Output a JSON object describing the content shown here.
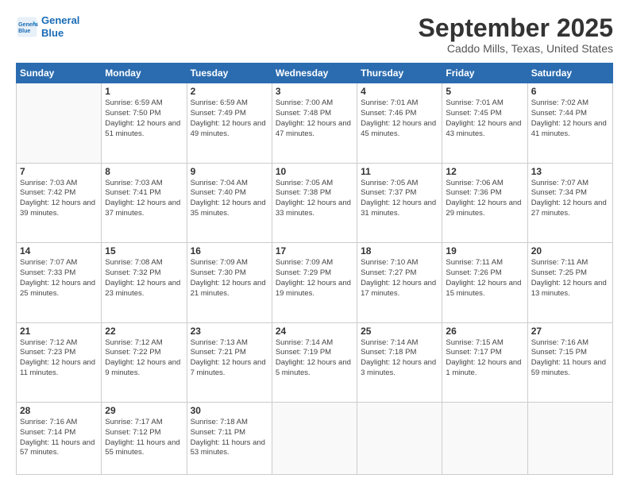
{
  "logo": {
    "line1": "General",
    "line2": "Blue"
  },
  "title": "September 2025",
  "location": "Caddo Mills, Texas, United States",
  "days_of_week": [
    "Sunday",
    "Monday",
    "Tuesday",
    "Wednesday",
    "Thursday",
    "Friday",
    "Saturday"
  ],
  "weeks": [
    [
      {
        "day": "",
        "sunrise": "",
        "sunset": "",
        "daylight": ""
      },
      {
        "day": "1",
        "sunrise": "Sunrise: 6:59 AM",
        "sunset": "Sunset: 7:50 PM",
        "daylight": "Daylight: 12 hours and 51 minutes."
      },
      {
        "day": "2",
        "sunrise": "Sunrise: 6:59 AM",
        "sunset": "Sunset: 7:49 PM",
        "daylight": "Daylight: 12 hours and 49 minutes."
      },
      {
        "day": "3",
        "sunrise": "Sunrise: 7:00 AM",
        "sunset": "Sunset: 7:48 PM",
        "daylight": "Daylight: 12 hours and 47 minutes."
      },
      {
        "day": "4",
        "sunrise": "Sunrise: 7:01 AM",
        "sunset": "Sunset: 7:46 PM",
        "daylight": "Daylight: 12 hours and 45 minutes."
      },
      {
        "day": "5",
        "sunrise": "Sunrise: 7:01 AM",
        "sunset": "Sunset: 7:45 PM",
        "daylight": "Daylight: 12 hours and 43 minutes."
      },
      {
        "day": "6",
        "sunrise": "Sunrise: 7:02 AM",
        "sunset": "Sunset: 7:44 PM",
        "daylight": "Daylight: 12 hours and 41 minutes."
      }
    ],
    [
      {
        "day": "7",
        "sunrise": "Sunrise: 7:03 AM",
        "sunset": "Sunset: 7:42 PM",
        "daylight": "Daylight: 12 hours and 39 minutes."
      },
      {
        "day": "8",
        "sunrise": "Sunrise: 7:03 AM",
        "sunset": "Sunset: 7:41 PM",
        "daylight": "Daylight: 12 hours and 37 minutes."
      },
      {
        "day": "9",
        "sunrise": "Sunrise: 7:04 AM",
        "sunset": "Sunset: 7:40 PM",
        "daylight": "Daylight: 12 hours and 35 minutes."
      },
      {
        "day": "10",
        "sunrise": "Sunrise: 7:05 AM",
        "sunset": "Sunset: 7:38 PM",
        "daylight": "Daylight: 12 hours and 33 minutes."
      },
      {
        "day": "11",
        "sunrise": "Sunrise: 7:05 AM",
        "sunset": "Sunset: 7:37 PM",
        "daylight": "Daylight: 12 hours and 31 minutes."
      },
      {
        "day": "12",
        "sunrise": "Sunrise: 7:06 AM",
        "sunset": "Sunset: 7:36 PM",
        "daylight": "Daylight: 12 hours and 29 minutes."
      },
      {
        "day": "13",
        "sunrise": "Sunrise: 7:07 AM",
        "sunset": "Sunset: 7:34 PM",
        "daylight": "Daylight: 12 hours and 27 minutes."
      }
    ],
    [
      {
        "day": "14",
        "sunrise": "Sunrise: 7:07 AM",
        "sunset": "Sunset: 7:33 PM",
        "daylight": "Daylight: 12 hours and 25 minutes."
      },
      {
        "day": "15",
        "sunrise": "Sunrise: 7:08 AM",
        "sunset": "Sunset: 7:32 PM",
        "daylight": "Daylight: 12 hours and 23 minutes."
      },
      {
        "day": "16",
        "sunrise": "Sunrise: 7:09 AM",
        "sunset": "Sunset: 7:30 PM",
        "daylight": "Daylight: 12 hours and 21 minutes."
      },
      {
        "day": "17",
        "sunrise": "Sunrise: 7:09 AM",
        "sunset": "Sunset: 7:29 PM",
        "daylight": "Daylight: 12 hours and 19 minutes."
      },
      {
        "day": "18",
        "sunrise": "Sunrise: 7:10 AM",
        "sunset": "Sunset: 7:27 PM",
        "daylight": "Daylight: 12 hours and 17 minutes."
      },
      {
        "day": "19",
        "sunrise": "Sunrise: 7:11 AM",
        "sunset": "Sunset: 7:26 PM",
        "daylight": "Daylight: 12 hours and 15 minutes."
      },
      {
        "day": "20",
        "sunrise": "Sunrise: 7:11 AM",
        "sunset": "Sunset: 7:25 PM",
        "daylight": "Daylight: 12 hours and 13 minutes."
      }
    ],
    [
      {
        "day": "21",
        "sunrise": "Sunrise: 7:12 AM",
        "sunset": "Sunset: 7:23 PM",
        "daylight": "Daylight: 12 hours and 11 minutes."
      },
      {
        "day": "22",
        "sunrise": "Sunrise: 7:12 AM",
        "sunset": "Sunset: 7:22 PM",
        "daylight": "Daylight: 12 hours and 9 minutes."
      },
      {
        "day": "23",
        "sunrise": "Sunrise: 7:13 AM",
        "sunset": "Sunset: 7:21 PM",
        "daylight": "Daylight: 12 hours and 7 minutes."
      },
      {
        "day": "24",
        "sunrise": "Sunrise: 7:14 AM",
        "sunset": "Sunset: 7:19 PM",
        "daylight": "Daylight: 12 hours and 5 minutes."
      },
      {
        "day": "25",
        "sunrise": "Sunrise: 7:14 AM",
        "sunset": "Sunset: 7:18 PM",
        "daylight": "Daylight: 12 hours and 3 minutes."
      },
      {
        "day": "26",
        "sunrise": "Sunrise: 7:15 AM",
        "sunset": "Sunset: 7:17 PM",
        "daylight": "Daylight: 12 hours and 1 minute."
      },
      {
        "day": "27",
        "sunrise": "Sunrise: 7:16 AM",
        "sunset": "Sunset: 7:15 PM",
        "daylight": "Daylight: 11 hours and 59 minutes."
      }
    ],
    [
      {
        "day": "28",
        "sunrise": "Sunrise: 7:16 AM",
        "sunset": "Sunset: 7:14 PM",
        "daylight": "Daylight: 11 hours and 57 minutes."
      },
      {
        "day": "29",
        "sunrise": "Sunrise: 7:17 AM",
        "sunset": "Sunset: 7:12 PM",
        "daylight": "Daylight: 11 hours and 55 minutes."
      },
      {
        "day": "30",
        "sunrise": "Sunrise: 7:18 AM",
        "sunset": "Sunset: 7:11 PM",
        "daylight": "Daylight: 11 hours and 53 minutes."
      },
      {
        "day": "",
        "sunrise": "",
        "sunset": "",
        "daylight": ""
      },
      {
        "day": "",
        "sunrise": "",
        "sunset": "",
        "daylight": ""
      },
      {
        "day": "",
        "sunrise": "",
        "sunset": "",
        "daylight": ""
      },
      {
        "day": "",
        "sunrise": "",
        "sunset": "",
        "daylight": ""
      }
    ]
  ]
}
